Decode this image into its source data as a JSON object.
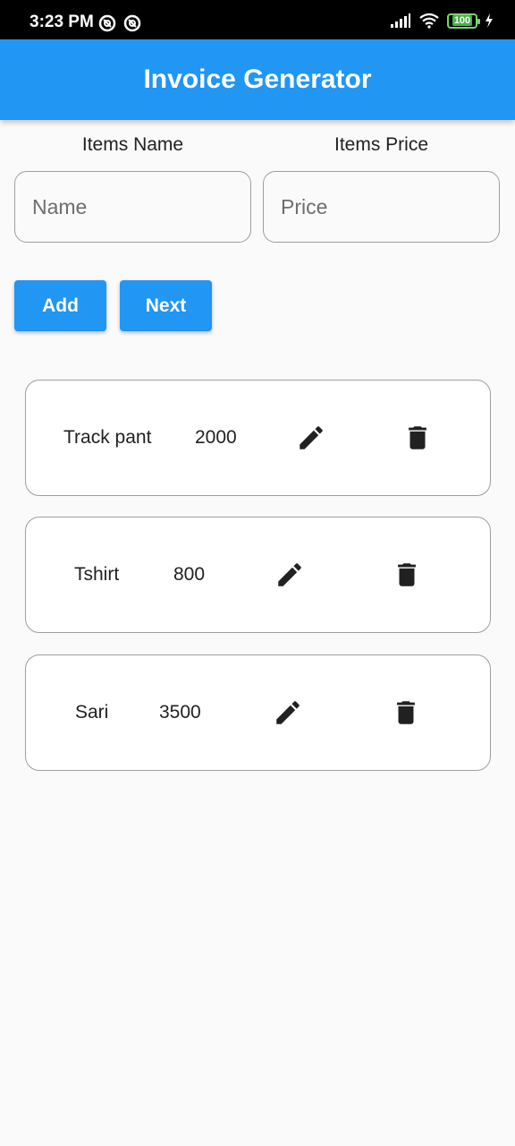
{
  "status": {
    "time": "3:23 PM",
    "battery": "100"
  },
  "app_bar": {
    "title": "Invoice Generator",
    "color": "#2196f3"
  },
  "form": {
    "name_label": "Items Name",
    "price_label": "Items Price",
    "name_placeholder": "Name",
    "price_placeholder": "Price"
  },
  "buttons": {
    "add": "Add",
    "next": "Next"
  },
  "items": [
    {
      "name": "Track pant",
      "price": "2000"
    },
    {
      "name": "Tshirt",
      "price": "800"
    },
    {
      "name": "Sari",
      "price": "3500"
    }
  ],
  "icons": {
    "edit": "pencil-icon",
    "delete": "trash-icon"
  }
}
